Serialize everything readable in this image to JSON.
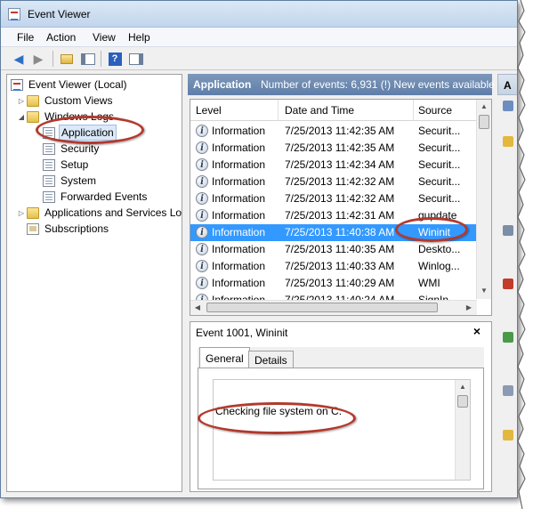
{
  "window": {
    "title": "Event Viewer"
  },
  "menu": [
    "File",
    "Action",
    "View",
    "Help"
  ],
  "toolbar": {
    "icons": [
      "back-arrow-icon",
      "forward-arrow-icon",
      "up-folder-icon",
      "show-hide-tree-icon",
      "help-icon",
      "show-hide-action-pane-icon"
    ]
  },
  "tree": {
    "root": "Event Viewer (Local)",
    "custom_views": "Custom Views",
    "windows_logs": "Windows Logs",
    "logs": [
      "Application",
      "Security",
      "Setup",
      "System",
      "Forwarded Events"
    ],
    "apps_services": "Applications and Services Lo",
    "subscriptions": "Subscriptions"
  },
  "log_header": {
    "name": "Application",
    "info": "Number of events: 6,931 (!) New events available"
  },
  "events": {
    "columns": [
      "Level",
      "Date and Time",
      "Source"
    ],
    "selected_index": 6,
    "rows": [
      {
        "level": "Information",
        "date": "7/25/2013 11:42:35 AM",
        "source": "Securit..."
      },
      {
        "level": "Information",
        "date": "7/25/2013 11:42:35 AM",
        "source": "Securit..."
      },
      {
        "level": "Information",
        "date": "7/25/2013 11:42:34 AM",
        "source": "Securit..."
      },
      {
        "level": "Information",
        "date": "7/25/2013 11:42:32 AM",
        "source": "Securit..."
      },
      {
        "level": "Information",
        "date": "7/25/2013 11:42:32 AM",
        "source": "Securit..."
      },
      {
        "level": "Information",
        "date": "7/25/2013 11:42:31 AM",
        "source": "gupdate"
      },
      {
        "level": "Information",
        "date": "7/25/2013 11:40:38 AM",
        "source": "Wininit"
      },
      {
        "level": "Information",
        "date": "7/25/2013 11:40:35 AM",
        "source": "Deskto..."
      },
      {
        "level": "Information",
        "date": "7/25/2013 11:40:33 AM",
        "source": "Winlog..."
      },
      {
        "level": "Information",
        "date": "7/25/2013 11:40:29 AM",
        "source": "WMI"
      },
      {
        "level": "Information",
        "date": "7/25/2013 11:40:24 AM",
        "source": "SignIn..."
      }
    ]
  },
  "detail": {
    "title": "Event 1001, Wininit",
    "close": "×",
    "tabs": [
      "General",
      "Details"
    ],
    "active_tab": "General",
    "message": "Checking file system on C:"
  },
  "actions_pane": {
    "heading": "A"
  },
  "colors": {
    "highlight": "#b2392c",
    "selection": "#3399ff",
    "header_band": "#6a87ae"
  }
}
